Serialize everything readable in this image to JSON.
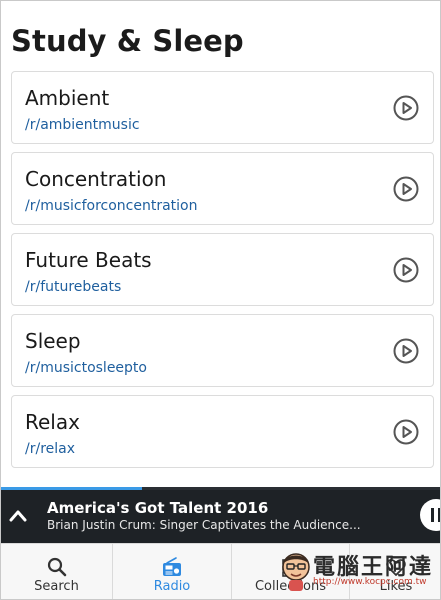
{
  "page": {
    "title": "Study & Sleep"
  },
  "playlists": [
    {
      "title": "Ambient",
      "subreddit": "/r/ambientmusic",
      "icon": "play-circle-icon"
    },
    {
      "title": "Concentration",
      "subreddit": "/r/musicforconcentration",
      "icon": "play-circle-icon"
    },
    {
      "title": "Future Beats",
      "subreddit": "/r/futurebeats",
      "icon": "play-circle-icon"
    },
    {
      "title": "Sleep",
      "subreddit": "/r/musictosleepto",
      "icon": "play-circle-icon"
    },
    {
      "title": "Relax",
      "subreddit": "/r/relax",
      "icon": "play-circle-icon"
    }
  ],
  "now_playing": {
    "title": "America's Got Talent 2016",
    "subtitle": "Brian Justin Crum: Singer Captivates the Audience...",
    "progress": 0.32,
    "expand_icon": "chevron-up-icon",
    "control_icon": "pause-icon"
  },
  "tabs": [
    {
      "label": "Search",
      "icon": "search-icon",
      "active": false
    },
    {
      "label": "Radio",
      "icon": "radio-icon",
      "active": true
    },
    {
      "label": "Collections",
      "icon": "collections-icon",
      "active": false
    },
    {
      "label": "Likes",
      "icon": "heart-icon",
      "active": false
    }
  ],
  "watermark": {
    "text": "電腦王阿達",
    "url": "http://www.kocpc.com.tw"
  },
  "colors": {
    "accent": "#2f8ae0",
    "link": "#1f5f9e",
    "player_bg": "#1e2226",
    "progress": "#3a9ae6"
  }
}
